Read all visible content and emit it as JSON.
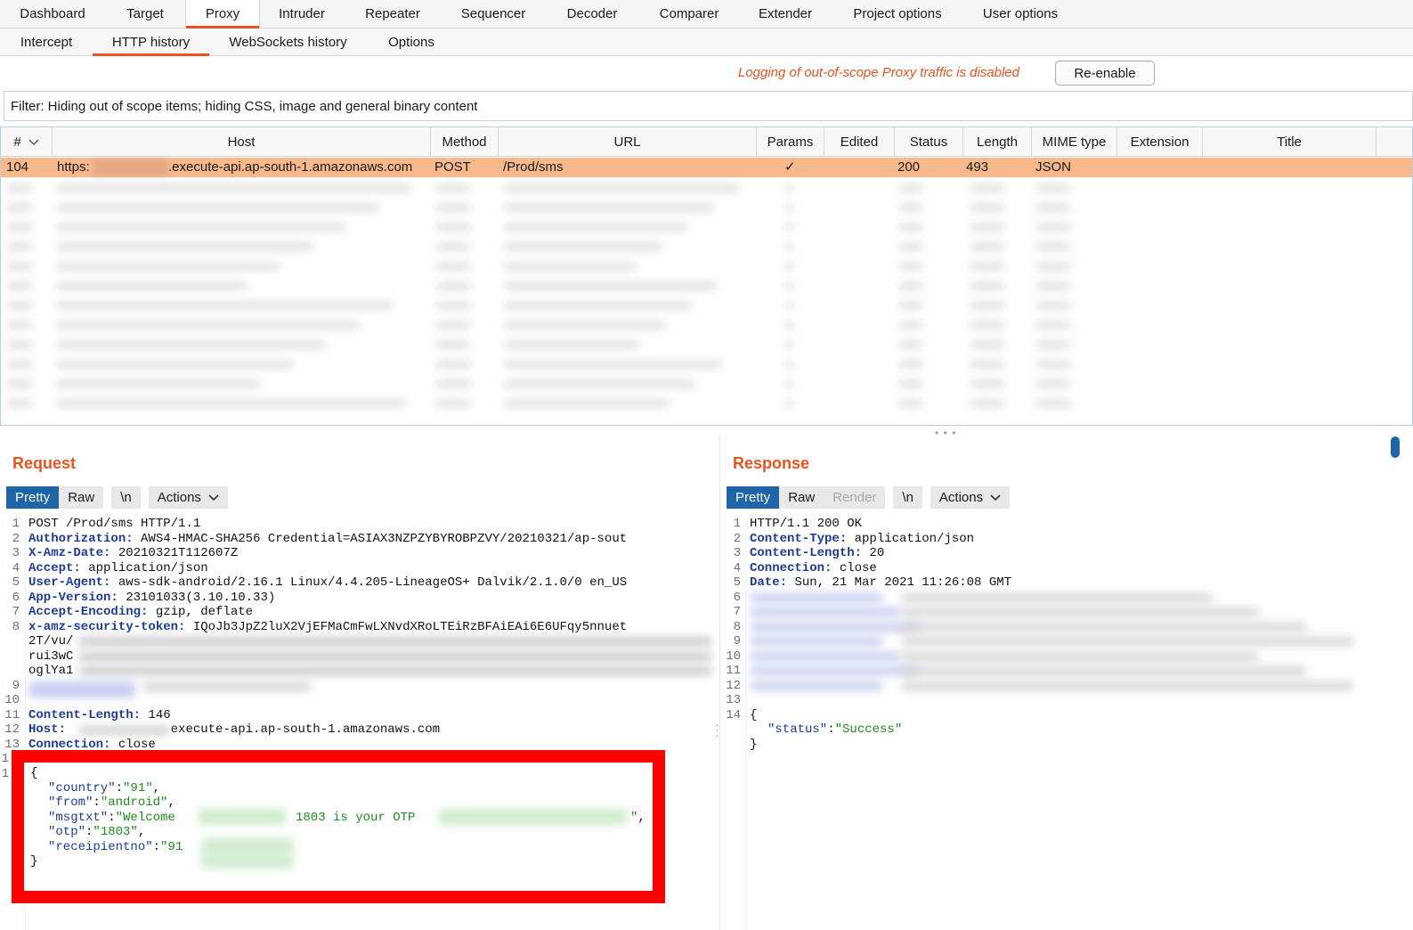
{
  "topnav": {
    "tabs": [
      "Dashboard",
      "Target",
      "Proxy",
      "Intruder",
      "Repeater",
      "Sequencer",
      "Decoder",
      "Comparer",
      "Extender",
      "Project options",
      "User options"
    ],
    "active": "Proxy"
  },
  "subnav": {
    "tabs": [
      "Intercept",
      "HTTP history",
      "WebSockets history",
      "Options"
    ],
    "active": "HTTP history"
  },
  "logbar": {
    "message": "Logging of out-of-scope Proxy traffic is disabled",
    "button": "Re-enable"
  },
  "filter": {
    "text": "Filter: Hiding out of scope items;  hiding CSS, image and general binary content"
  },
  "table": {
    "columns": [
      "#",
      "Host",
      "Method",
      "URL",
      "Params",
      "Edited",
      "Status",
      "Length",
      "MIME type",
      "Extension",
      "Title"
    ],
    "sort_icon": "chevron-down-icon",
    "selected_row": {
      "num": "104",
      "host_prefix": "https:",
      "host_suffix": ".execute-api.ap-south-1.amazonaws.com",
      "method": "POST",
      "url": "/Prod/sms",
      "params": "✓",
      "edited": "",
      "status": "200",
      "length": "493",
      "mime": "JSON",
      "extension": "",
      "title": ""
    },
    "selected_color": "#f7b98c"
  },
  "request": {
    "title": "Request",
    "toolbar": {
      "pretty": "Pretty",
      "raw": "Raw",
      "newline": "\\n",
      "actions": "Actions"
    },
    "lines": [
      {
        "n": "1",
        "head": "",
        "text": "POST /Prod/sms HTTP/1.1"
      },
      {
        "n": "2",
        "head": "Authorization:",
        "text": " AWS4-HMAC-SHA256 Credential=ASIAX3NZPZYBYROBPZVY/20210321/ap-sout"
      },
      {
        "n": "3",
        "head": "X-Amz-Date:",
        "text": " 20210321T112607Z"
      },
      {
        "n": "4",
        "head": "Accept:",
        "text": " application/json"
      },
      {
        "n": "5",
        "head": "User-Agent:",
        "text": " aws-sdk-android/2.16.1 Linux/4.4.205-LineageOS+ Dalvik/2.1.0/0 en_US"
      },
      {
        "n": "6",
        "head": "App-Version:",
        "text": " 23101033(3.10.10.33)"
      },
      {
        "n": "7",
        "head": "Accept-Encoding:",
        "text": " gzip, deflate"
      },
      {
        "n": "8",
        "head": "x-amz-security-token:",
        "text": " IQoJb3JpZ2luX2VjEFMaCmFwLXNvdXRoLTEiRzBFAiEAi6E6UFqy5nnuet"
      }
    ],
    "token_cont": [
      "2T/vu/",
      "rui3wC",
      "oglYa1"
    ],
    "lines_b": [
      {
        "n": "11",
        "head": "Content-Length:",
        "text": " 146"
      },
      {
        "n": "12",
        "head": "Host:",
        "text": "              execute-api.ap-south-1.amazonaws.com"
      },
      {
        "n": "13",
        "head": "Connection:",
        "text": " close"
      }
    ],
    "ln9": "9",
    "ln10": "10",
    "ln14": "1",
    "ln15": "1",
    "body": {
      "open": "{",
      "k_country": "\"country\"",
      "v_country": "\"91\"",
      "k_from": "\"from\"",
      "v_from": "\"android\"",
      "k_msg": "\"msgtxt\"",
      "v_msg_a": "\"Welcome",
      "v_msg_b": "1803 is your OTP",
      "v_msg_c": "\",",
      "k_otp": "\"otp\"",
      "v_otp": "\"1803\"",
      "k_rcpt": "\"receipientno\"",
      "v_rcpt": "\"91",
      "close": "}"
    }
  },
  "response": {
    "title": "Response",
    "toolbar": {
      "pretty": "Pretty",
      "raw": "Raw",
      "render": "Render",
      "newline": "\\n",
      "actions": "Actions"
    },
    "lines": [
      {
        "n": "1",
        "head": "",
        "text": "HTTP/1.1 200 OK"
      },
      {
        "n": "2",
        "head": "Content-Type:",
        "text": " application/json"
      },
      {
        "n": "3",
        "head": "Content-Length:",
        "text": " 20"
      },
      {
        "n": "4",
        "head": "Connection:",
        "text": " close"
      },
      {
        "n": "5",
        "head": "Date:",
        "text": " Sun, 21 Mar 2021 11:26:08 GMT"
      }
    ],
    "blurred_line_numbers": [
      "6",
      "7",
      "8",
      "9",
      "10",
      "11",
      "12",
      "13"
    ],
    "ln14": "14",
    "body": {
      "open": "{",
      "key": "\"status\"",
      "value": "\"Success\"",
      "close": "}"
    }
  },
  "colors": {
    "accent": "#e8531e",
    "selected_tab": "#1e64a8",
    "header_key": "#1f3b9a",
    "json_value": "#1e8a1e",
    "highlight_box": "#ff0000"
  }
}
